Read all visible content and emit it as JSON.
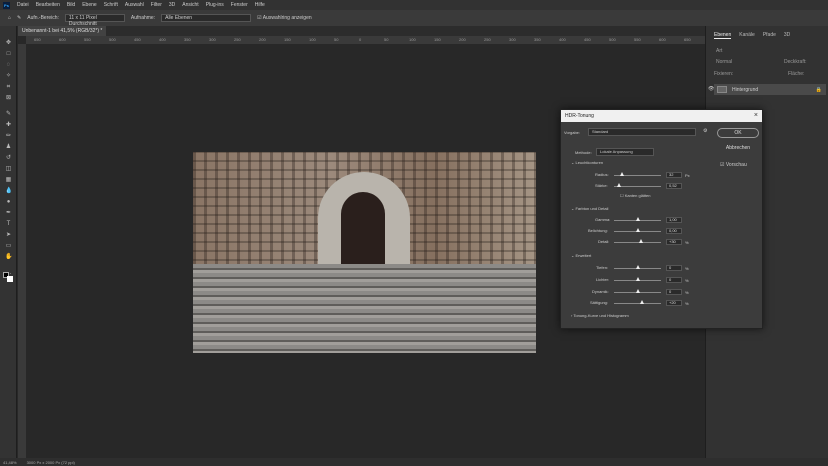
{
  "app": {
    "logo": "Ps",
    "menu": [
      "Datei",
      "Bearbeiten",
      "Bild",
      "Ebene",
      "Schrift",
      "Auswahl",
      "Filter",
      "3D",
      "Ansicht",
      "Plug-ins",
      "Fenster",
      "Hilfe"
    ]
  },
  "options": {
    "size_label": "Aufn.-Bereich:",
    "size_value": "11 x 11 Pixel Durchschnitt",
    "sample_label": "Aufnahme:",
    "sample_value": "Alle Ebenen",
    "show_ring": "Auswahlring anzeigen"
  },
  "document": {
    "tab": "Unbenannt-1 bei 41,5% (RGB/32*) *",
    "ruler": [
      "650",
      "600",
      "550",
      "500",
      "450",
      "400",
      "350",
      "300",
      "250",
      "200",
      "150",
      "100",
      "50",
      "0",
      "50",
      "100",
      "150",
      "200",
      "250",
      "300",
      "350",
      "400",
      "450",
      "500",
      "550",
      "600",
      "650"
    ]
  },
  "layers_panel": {
    "tabs": [
      "Ebenen",
      "Kanäle",
      "Pfade",
      "3D"
    ],
    "filter": "Art",
    "blend": "Normal",
    "opacity_label": "Deckkraft:",
    "lock_label": "Fixieren:",
    "fill_label": "Fläche:",
    "layer_name": "Hintergrund"
  },
  "status": {
    "zoom": "41,48%",
    "size": "3000 Px x 2000 Px (72 ppi)"
  },
  "dialog": {
    "title": "HDR-Tonung",
    "preset_label": "Vorgabe:",
    "preset": "Standard",
    "method_label": "Methode:",
    "method": "Lokale Anpassung",
    "ok": "OK",
    "cancel": "Abbrechen",
    "preview": "Vorschau",
    "glow_section": "Leuchtkonturen",
    "radius_label": "Radius:",
    "radius": "32",
    "radius_unit": "Px",
    "strength_label": "Stärke:",
    "strength": "0,52",
    "smooth_edges": "Kanten glätten",
    "tone_section": "Farbton und Detail",
    "gamma_label": "Gamma:",
    "gamma": "1,00",
    "exposure_label": "Belichtung:",
    "exposure": "0,00",
    "detail_label": "Detail:",
    "detail": "+30",
    "pct": "%",
    "adv_section": "Erweitert",
    "shadows_label": "Tiefen:",
    "shadows": "0",
    "highlights_label": "Lichter:",
    "highlights": "0",
    "vibrance_label": "Dynamik:",
    "vibrance": "0",
    "saturation_label": "Sättigung:",
    "saturation": "+20",
    "curve_section": "Tonung-Kurve und Histogramm"
  }
}
